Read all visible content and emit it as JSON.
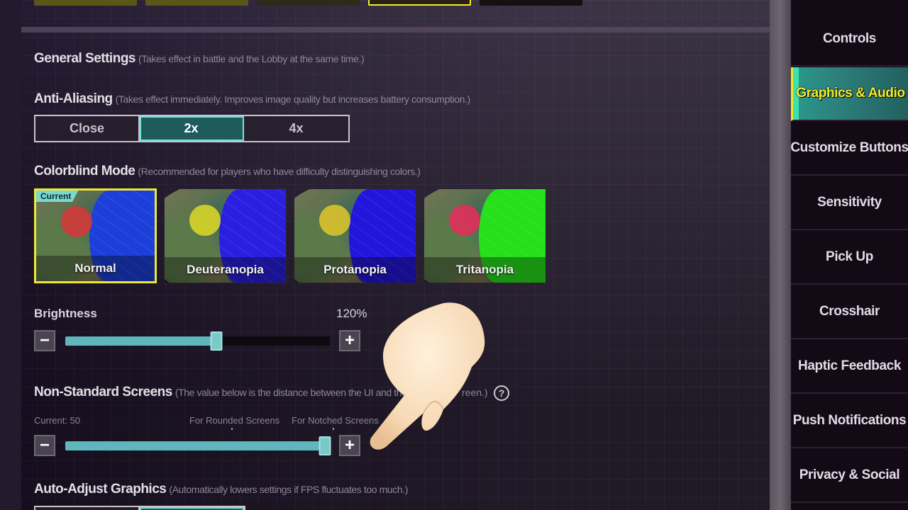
{
  "top_strip": {
    "thumbnails": 5,
    "selected_index": 3
  },
  "general": {
    "title": "General Settings",
    "hint": "(Takes effect in battle and the Lobby at the same time.)"
  },
  "anti_aliasing": {
    "title": "Anti-Aliasing",
    "hint": "(Takes effect immediately. Improves image quality but increases battery consumption.)",
    "options": [
      "Close",
      "2x",
      "4x"
    ],
    "selected": "2x"
  },
  "colorblind": {
    "title": "Colorblind Mode",
    "hint": "(Recommended for players who have difficulty distinguishing colors.)",
    "current_tag": "Current",
    "modes": [
      {
        "label": "Normal",
        "zone_color": "#d23a3a",
        "sea_color": "#1b3fd8",
        "current": true
      },
      {
        "label": "Deuteranopia",
        "zone_color": "#d6d42a",
        "sea_color": "#2a1fe0",
        "current": false
      },
      {
        "label": "Protanopia",
        "zone_color": "#d9c22e",
        "sea_color": "#2215dc",
        "current": false
      },
      {
        "label": "Tritanopia",
        "zone_color": "#e0305a",
        "sea_color": "#25e01a",
        "current": false
      }
    ]
  },
  "brightness": {
    "title": "Brightness",
    "value_text": "120%",
    "fraction": 0.57,
    "minus_icon": "minus-icon",
    "plus_icon": "plus-icon"
  },
  "non_standard": {
    "title": "Non-Standard Screens",
    "hint_visible_start": "(The value below is the distance between the UI and the",
    "hint_visible_end": "reen.)",
    "current_text": "Current: 50",
    "rounded_label": "For Rounded Screens",
    "notched_label": "For Notched Screens",
    "fraction": 1.0,
    "help_glyph": "?"
  },
  "auto_adjust": {
    "title": "Auto-Adjust Graphics",
    "hint": "(Automatically lowers settings if FPS fluctuates too much.)",
    "selected_index": 1
  },
  "sidebar": {
    "items": [
      {
        "label": "Controls",
        "active": false
      },
      {
        "label": "Graphics & Audio",
        "active": true
      },
      {
        "label": "Customize Buttons",
        "active": false
      },
      {
        "label": "Sensitivity",
        "active": false
      },
      {
        "label": "Pick Up",
        "active": false
      },
      {
        "label": "Crosshair",
        "active": false
      },
      {
        "label": "Haptic Feedback",
        "active": false
      },
      {
        "label": "Push Notifications",
        "active": false
      },
      {
        "label": "Privacy & Social",
        "active": false
      }
    ]
  },
  "overlay": {
    "pointer": "pointing-hand-emoji"
  }
}
